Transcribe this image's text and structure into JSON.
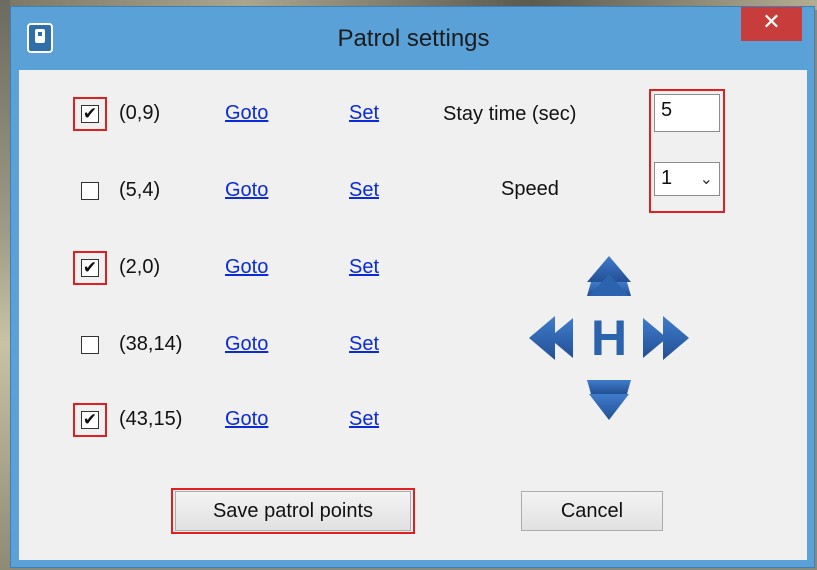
{
  "window": {
    "title": "Patrol settings",
    "close_label": "✕"
  },
  "patrol_points": [
    {
      "checked": true,
      "mark": "✔",
      "coord": "(0,9)",
      "goto": "Goto",
      "set": "Set"
    },
    {
      "checked": false,
      "mark": "",
      "coord": "(5,4)",
      "goto": "Goto",
      "set": "Set"
    },
    {
      "checked": true,
      "mark": "✔",
      "coord": "(2,0)",
      "goto": "Goto",
      "set": "Set"
    },
    {
      "checked": false,
      "mark": "",
      "coord": "(38,14)",
      "goto": "Goto",
      "set": "Set"
    },
    {
      "checked": true,
      "mark": "✔",
      "coord": "(43,15)",
      "goto": "Goto",
      "set": "Set"
    }
  ],
  "settings": {
    "stay_time_label": "Stay time (sec)",
    "stay_time_value": "5",
    "speed_label": "Speed",
    "speed_value": "1"
  },
  "dpad": {
    "center_label": "H",
    "color": "#2b63ad"
  },
  "buttons": {
    "save": "Save patrol points",
    "cancel": "Cancel"
  },
  "colors": {
    "titlebar": "#5aa1d8",
    "close": "#c83c3c",
    "highlight": "#e02020",
    "link": "#0a2bd6"
  }
}
